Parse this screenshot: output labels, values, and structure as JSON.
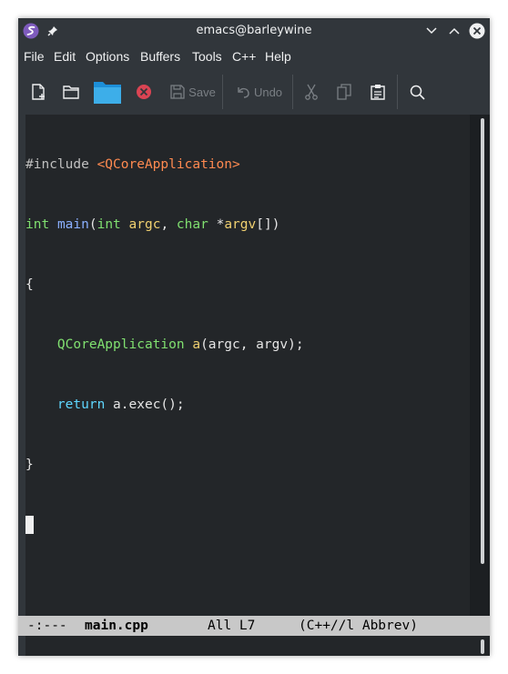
{
  "window": {
    "title": "emacs@barleywine"
  },
  "menu": [
    "File",
    "Edit",
    "Options",
    "Buffers",
    "Tools",
    "C++",
    "Help"
  ],
  "toolbar": {
    "save_label": "Save",
    "undo_label": "Undo"
  },
  "code": {
    "line1_directive": "#include",
    "line1_header": "<QCoreApplication>",
    "line2_type": "int",
    "line2_name": "main",
    "line2_paren": "(",
    "line2_ptype1": "int",
    "line2_param1": "argc",
    "line2_comma": ", ",
    "line2_ptype2": "char",
    "line2_star": " *",
    "line2_param2": "argv",
    "line2_end": "[])",
    "line3": "{",
    "line4_type": "QCoreApplication",
    "line4_var": "a",
    "line4_rest": "(argc, argv);",
    "line5_kw": "return",
    "line5_rest": " a.exec();",
    "line6": "}"
  },
  "modeline": {
    "status": "-:---",
    "buffer": "main.cpp",
    "position": "All L7",
    "modes": "(C++//l Abbrev)"
  }
}
